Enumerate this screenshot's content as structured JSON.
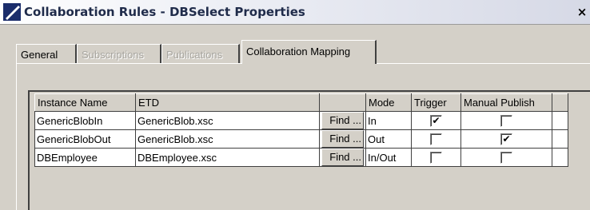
{
  "window": {
    "title": "Collaboration Rules - DBSelect Properties",
    "close_label": "×"
  },
  "tabs": [
    {
      "label": "General",
      "state": "normal"
    },
    {
      "label": "Subscriptions",
      "state": "disabled"
    },
    {
      "label": "Publications",
      "state": "disabled"
    },
    {
      "label": "Collaboration Mapping",
      "state": "active"
    }
  ],
  "table": {
    "columns": [
      "Instance Name",
      "ETD",
      "",
      "Mode",
      "Trigger",
      "Manual Publish",
      ""
    ],
    "find_label": "Find ...",
    "rows": [
      {
        "instance": "GenericBlobIn",
        "etd": "GenericBlob.xsc",
        "mode": "In",
        "trigger": "✔",
        "manual_publish": ""
      },
      {
        "instance": "GenericBlobOut",
        "etd": "GenericBlob.xsc",
        "mode": "Out",
        "trigger": "",
        "manual_publish": "✔"
      },
      {
        "instance": "DBEmployee",
        "etd": "DBEmployee.xsc",
        "mode": "In/Out",
        "trigger": "",
        "manual_publish": ""
      }
    ]
  }
}
